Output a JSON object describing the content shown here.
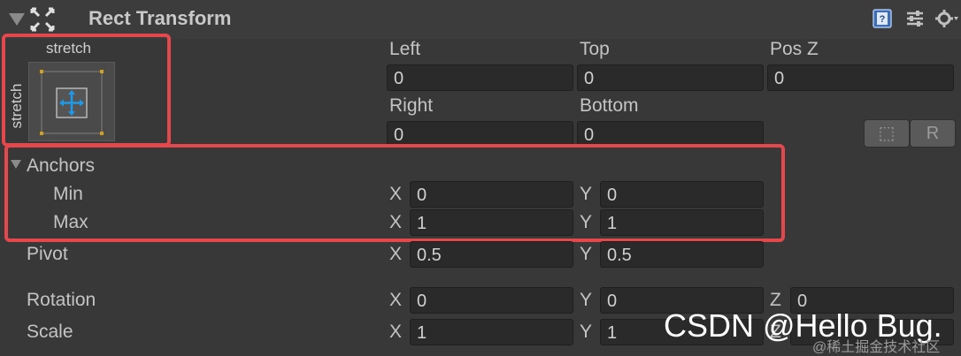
{
  "component": {
    "title": "Rect Transform",
    "icons": [
      "help-book-icon",
      "preset-sliders-icon",
      "settings-gear-icon"
    ]
  },
  "anchor_preset": {
    "horizontal_label": "stretch",
    "vertical_label": "stretch"
  },
  "position": {
    "left": {
      "label": "Left",
      "value": "0"
    },
    "top": {
      "label": "Top",
      "value": "0"
    },
    "pos_z": {
      "label": "Pos Z",
      "value": "0"
    },
    "right": {
      "label": "Right",
      "value": "0"
    },
    "bottom": {
      "label": "Bottom",
      "value": "0"
    }
  },
  "tools": {
    "blueprint_glyph": "⬚",
    "raw_label": "R"
  },
  "anchors": {
    "label": "Anchors",
    "min": {
      "label": "Min",
      "x_label": "X",
      "x": "0",
      "y_label": "Y",
      "y": "0"
    },
    "max": {
      "label": "Max",
      "x_label": "X",
      "x": "1",
      "y_label": "Y",
      "y": "1"
    }
  },
  "pivot": {
    "label": "Pivot",
    "x_label": "X",
    "x": "0.5",
    "y_label": "Y",
    "y": "0.5"
  },
  "rotation": {
    "label": "Rotation",
    "x_label": "X",
    "x": "0",
    "y_label": "Y",
    "y": "0",
    "z_label": "Z",
    "z": "0"
  },
  "scale": {
    "label": "Scale",
    "x_label": "X",
    "x": "1",
    "y_label": "Y",
    "y": "1",
    "z_label": "Z"
  },
  "watermark": {
    "text": "CSDN @Hello Bug.",
    "sub": "@稀土掘金技术社区"
  },
  "colors": {
    "highlight": "#e4484d",
    "accent_blue": "#1e9be8",
    "corner_gold": "#d4a017"
  }
}
